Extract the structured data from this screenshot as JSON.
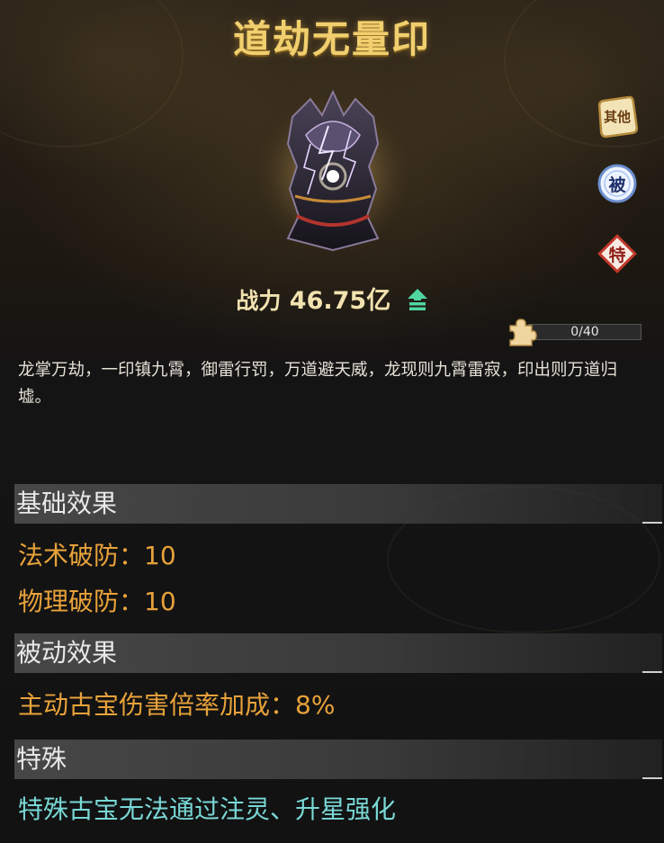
{
  "item": {
    "title": "道劫无量印",
    "power_label": "战力",
    "power_value": "46.75亿",
    "fragment_count": "0/40",
    "fragment_progress": 0,
    "description": "龙掌万劫，一印镇九霄，御雷行罚，万道避天威，龙现则九霄雷寂，印出则万道归墟。"
  },
  "side_tabs": [
    {
      "label": "其他",
      "icon": "scroll-badge-icon",
      "color": "#efd9a4"
    },
    {
      "label": "被",
      "icon": "blue-orb-badge-icon",
      "color": "#cfe3ff"
    },
    {
      "label": "特",
      "icon": "red-diamond-badge-icon",
      "color": "#e9b7a8"
    }
  ],
  "sections": {
    "basic": {
      "title": "基础效果",
      "lines": [
        "法术破防：10",
        "物理破防：10"
      ]
    },
    "passive": {
      "title": "被动效果",
      "lines": [
        "主动古宝伤害倍率加成：8%"
      ]
    },
    "special": {
      "title": "特殊",
      "lines": [
        "特殊古宝无法通过注灵、升星强化"
      ]
    }
  },
  "colors": {
    "title": "#f1cf6e",
    "effect_text": "#e8a23a",
    "special_text": "#79d8d6",
    "upgrade_arrow": "#4fd6a0"
  }
}
